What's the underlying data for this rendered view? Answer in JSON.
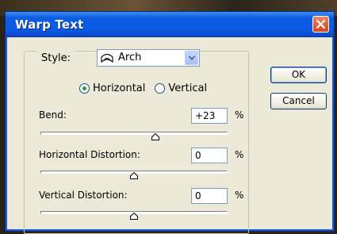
{
  "window": {
    "title": "Warp Text"
  },
  "style": {
    "label": "Style:",
    "selected": "Arch",
    "icon": "arch-warp-icon"
  },
  "orientation": {
    "options": [
      "Horizontal",
      "Vertical"
    ],
    "selected": "Horizontal"
  },
  "bend": {
    "label": "Bend:",
    "value": "+23",
    "unit": "%",
    "slider_fraction": 0.615
  },
  "horizontal_distortion": {
    "label": "Horizontal Distortion:",
    "value": "0",
    "unit": "%",
    "slider_fraction": 0.5
  },
  "vertical_distortion": {
    "label": "Vertical Distortion:",
    "value": "0",
    "unit": "%",
    "slider_fraction": 0.5
  },
  "buttons": {
    "ok": "OK",
    "cancel": "Cancel"
  },
  "colors": {
    "titlebar": "#0b5ce0",
    "close": "#d8441c",
    "radio_dot": "#21a121"
  }
}
